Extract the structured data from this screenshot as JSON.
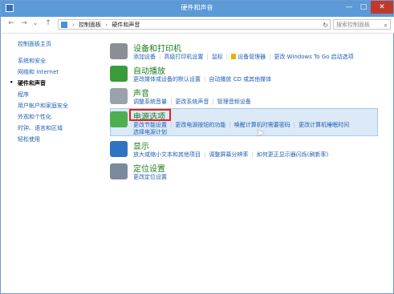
{
  "window": {
    "title": "硬件和声音",
    "minimize": "—",
    "maximize": "□",
    "close": "✕"
  },
  "nav": {
    "back": "←",
    "forward": "→",
    "recent": "⌄",
    "up": "↑",
    "breadcrumb": [
      "控制面板",
      "硬件和声音"
    ],
    "separator": "›",
    "refresh": "↻",
    "search_placeholder": "搜索控制面板",
    "search_icon": "⌕"
  },
  "sidebar": {
    "items": [
      {
        "label": "控制面板主页",
        "current": false
      },
      {
        "label": "系统和安全",
        "current": false
      },
      {
        "label": "网络和 Internet",
        "current": false
      },
      {
        "label": "硬件和声音",
        "current": true
      },
      {
        "label": "程序",
        "current": false
      },
      {
        "label": "用户帐户和家庭安全",
        "current": false
      },
      {
        "label": "外观和个性化",
        "current": false
      },
      {
        "label": "时钟、语言和区域",
        "current": false
      },
      {
        "label": "轻松使用",
        "current": false
      }
    ]
  },
  "categories": [
    {
      "title": "设备和打印机",
      "icon": "printer-icon",
      "links": [
        "添加设备",
        "高级打印机设置",
        "鼠标",
        "设备管理器",
        "更改 Windows To Go 启动选项"
      ]
    },
    {
      "title": "自动播放",
      "icon": "autoplay-icon",
      "links": [
        "更改媒体或设备的默认设置",
        "自动播放 CD 或其他媒体"
      ]
    },
    {
      "title": "声音",
      "icon": "speaker-icon",
      "links": [
        "调整系统音量",
        "更改系统声音",
        "管理音频设备"
      ]
    },
    {
      "title": "电源选项",
      "icon": "power-icon",
      "links": [
        "更改节能设置",
        "更改电源按钮的功能",
        "唤醒计算机时需要密码",
        "更改计算机睡眠时间"
      ],
      "links2": [
        "选择电源计划"
      ]
    },
    {
      "title": "显示",
      "icon": "display-icon",
      "links": [
        "放大或缩小文本和其他项目",
        "调整屏幕分辨率",
        "如何更正显示器闪烁(刷新率)"
      ]
    },
    {
      "title": "定位设置",
      "icon": "location-icon",
      "links": [
        "更改定位设置"
      ]
    }
  ]
}
